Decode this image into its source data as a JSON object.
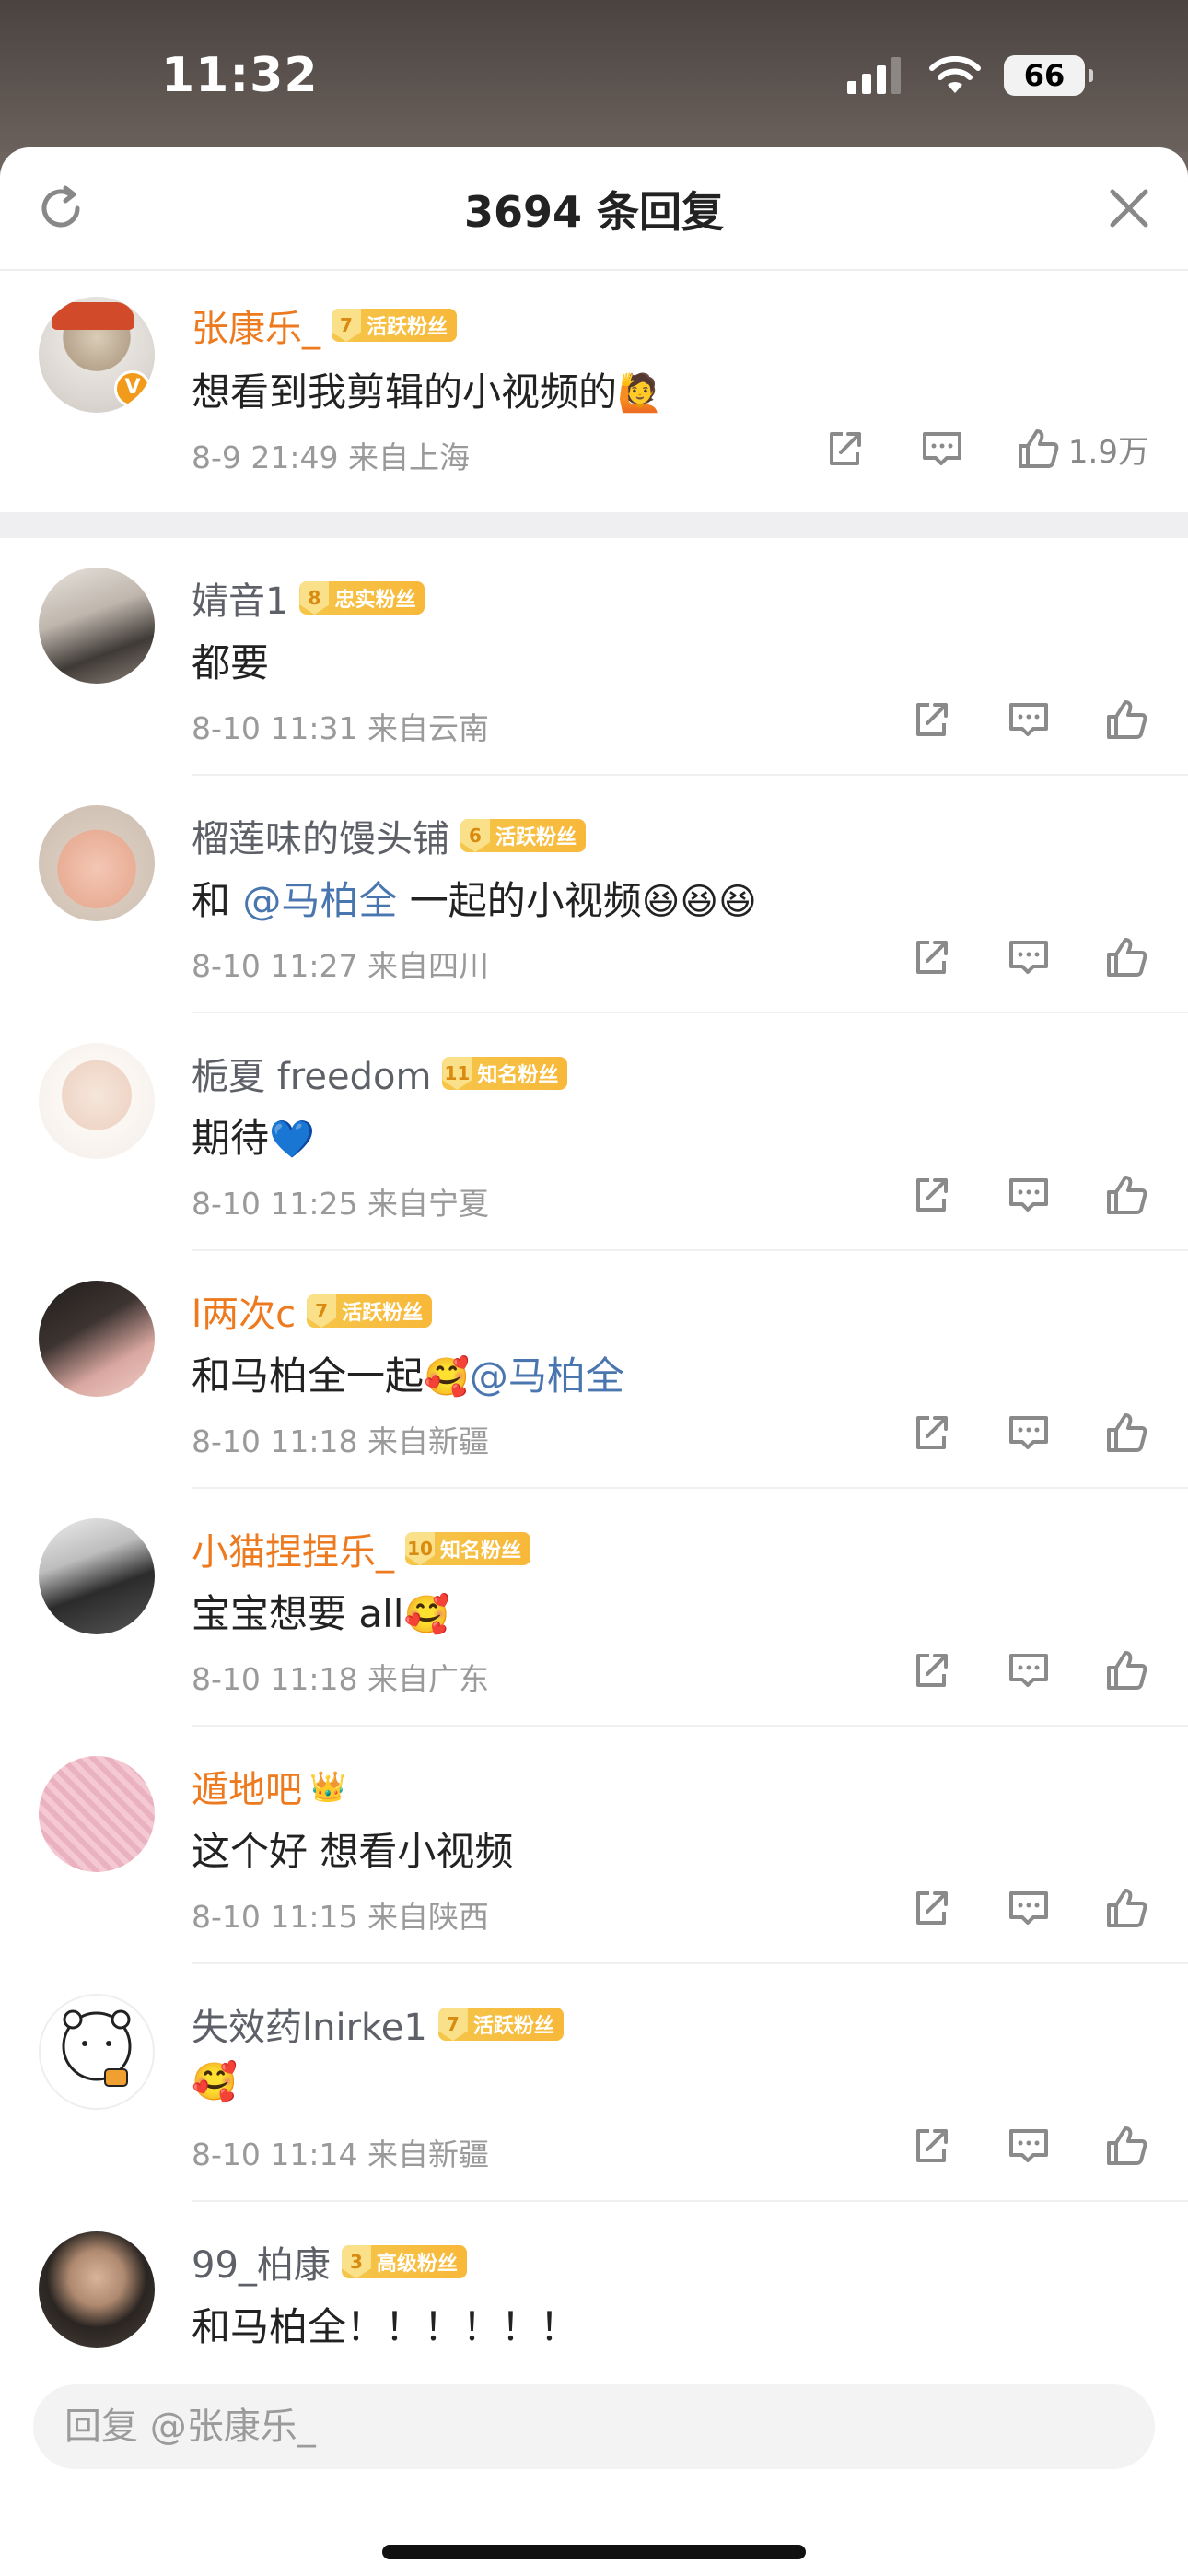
{
  "status": {
    "time": "11:32",
    "battery": "66"
  },
  "header": {
    "title": "3694 条回复"
  },
  "main_comment": {
    "name": "张康乐_",
    "badge_level": "7",
    "badge_text": "活跃粉丝",
    "text": "想看到我剪辑的小视频的",
    "emoji": "🙋",
    "meta": "8-9 21:49  来自上海",
    "likes": "1.9万"
  },
  "comments": [
    {
      "name": "婧音1",
      "badge_level": "8",
      "badge_text": "忠实粉丝",
      "text": "都要",
      "meta": "8-10 11:31  来自云南"
    },
    {
      "name": "榴莲味的馒头铺",
      "badge_level": "6",
      "badge_text": "活跃粉丝",
      "text_pre": "和 ",
      "mention": "@马柏全",
      "text_post": " 一起的小视频",
      "emoji": "😆😆😆",
      "meta": "8-10 11:27  来自四川"
    },
    {
      "name": "栀夏 freedom",
      "badge_level": "11",
      "badge_text": "知名粉丝",
      "text": "期待",
      "emoji": "💙",
      "meta": "8-10 11:25  来自宁夏"
    },
    {
      "name": "l两次c",
      "badge_level": "7",
      "badge_text": "活跃粉丝",
      "text_pre": "和马柏全一起",
      "emoji": "🥰",
      "mention": "@马柏全",
      "meta": "8-10 11:18  来自新疆"
    },
    {
      "name": "小猫捏捏乐_",
      "badge_level": "10",
      "badge_text": "知名粉丝",
      "text": "宝宝想要 all",
      "emoji": "🥰",
      "meta": "8-10 11:18  来自广东"
    },
    {
      "name": "遁地吧",
      "badge_icon": "👑",
      "text": "这个好 想看小视频",
      "meta": "8-10 11:15  来自陕西"
    },
    {
      "name": "失效药lnirke1",
      "badge_level": "7",
      "badge_text": "活跃粉丝",
      "emoji": "🥰",
      "meta": "8-10 11:14  来自新疆"
    },
    {
      "name": "99_柏康",
      "badge_level": "3",
      "badge_text": "高级粉丝",
      "text": "和马柏全！！！！！！"
    }
  ],
  "reply": {
    "placeholder": "回复 @张康乐_"
  }
}
